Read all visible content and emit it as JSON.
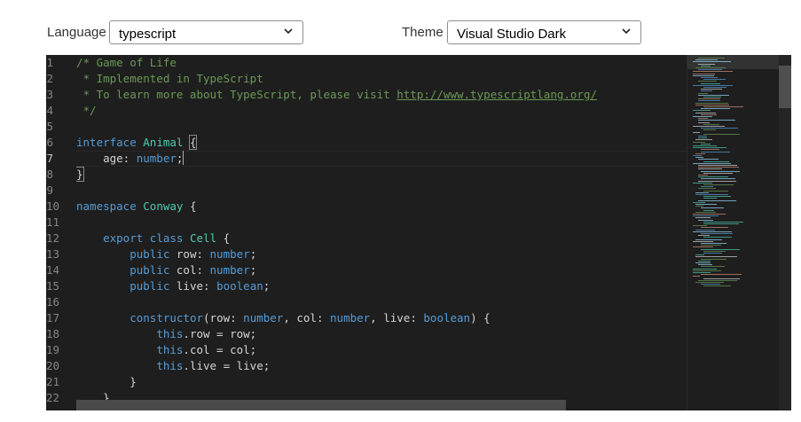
{
  "toolbar": {
    "language_label": "Language",
    "language_value": "typescript",
    "theme_label": "Theme",
    "theme_value": "Visual Studio Dark"
  },
  "editor": {
    "active_line": 7,
    "line_numbers": [
      "1",
      "2",
      "3",
      "4",
      "5",
      "6",
      "7",
      "8",
      "9",
      "10",
      "11",
      "12",
      "13",
      "14",
      "15",
      "16",
      "17",
      "18",
      "19",
      "20",
      "21",
      "22"
    ],
    "lines": [
      [
        [
          "c",
          "/* Game of Life"
        ]
      ],
      [
        [
          "c",
          " * Implemented in TypeScript"
        ]
      ],
      [
        [
          "c",
          " * To learn more about TypeScript, please visit "
        ],
        [
          "l",
          "http://www.typescriptlang.org/"
        ]
      ],
      [
        [
          "c",
          " */"
        ]
      ],
      [],
      [
        [
          "k",
          "interface"
        ],
        [
          "p",
          " "
        ],
        [
          "t",
          "Animal"
        ],
        [
          "p",
          " "
        ],
        [
          "b",
          "{"
        ]
      ],
      [
        [
          "p",
          "    age: "
        ],
        [
          "k",
          "number"
        ],
        [
          "p",
          ";"
        ]
      ],
      [
        [
          "b",
          "}"
        ]
      ],
      [],
      [
        [
          "k",
          "namespace"
        ],
        [
          "p",
          " "
        ],
        [
          "t",
          "Conway"
        ],
        [
          "p",
          " {"
        ]
      ],
      [],
      [
        [
          "p",
          "    "
        ],
        [
          "k",
          "export"
        ],
        [
          "p",
          " "
        ],
        [
          "k",
          "class"
        ],
        [
          "p",
          " "
        ],
        [
          "t",
          "Cell"
        ],
        [
          "p",
          " {"
        ]
      ],
      [
        [
          "p",
          "        "
        ],
        [
          "k",
          "public"
        ],
        [
          "p",
          " row: "
        ],
        [
          "k",
          "number"
        ],
        [
          "p",
          ";"
        ]
      ],
      [
        [
          "p",
          "        "
        ],
        [
          "k",
          "public"
        ],
        [
          "p",
          " col: "
        ],
        [
          "k",
          "number"
        ],
        [
          "p",
          ";"
        ]
      ],
      [
        [
          "p",
          "        "
        ],
        [
          "k",
          "public"
        ],
        [
          "p",
          " live: "
        ],
        [
          "k",
          "boolean"
        ],
        [
          "p",
          ";"
        ]
      ],
      [],
      [
        [
          "p",
          "        "
        ],
        [
          "k",
          "constructor"
        ],
        [
          "p",
          "(row: "
        ],
        [
          "k",
          "number"
        ],
        [
          "p",
          ", col: "
        ],
        [
          "k",
          "number"
        ],
        [
          "p",
          ", live: "
        ],
        [
          "k",
          "boolean"
        ],
        [
          "p",
          ") {"
        ]
      ],
      [
        [
          "p",
          "            "
        ],
        [
          "k",
          "this"
        ],
        [
          "p",
          ".row = row;"
        ]
      ],
      [
        [
          "p",
          "            "
        ],
        [
          "k",
          "this"
        ],
        [
          "p",
          ".col = col;"
        ]
      ],
      [
        [
          "p",
          "            "
        ],
        [
          "k",
          "this"
        ],
        [
          "p",
          ".live = live;"
        ]
      ],
      [
        [
          "p",
          "        }"
        ]
      ],
      [
        [
          "p",
          "    }"
        ]
      ]
    ]
  }
}
